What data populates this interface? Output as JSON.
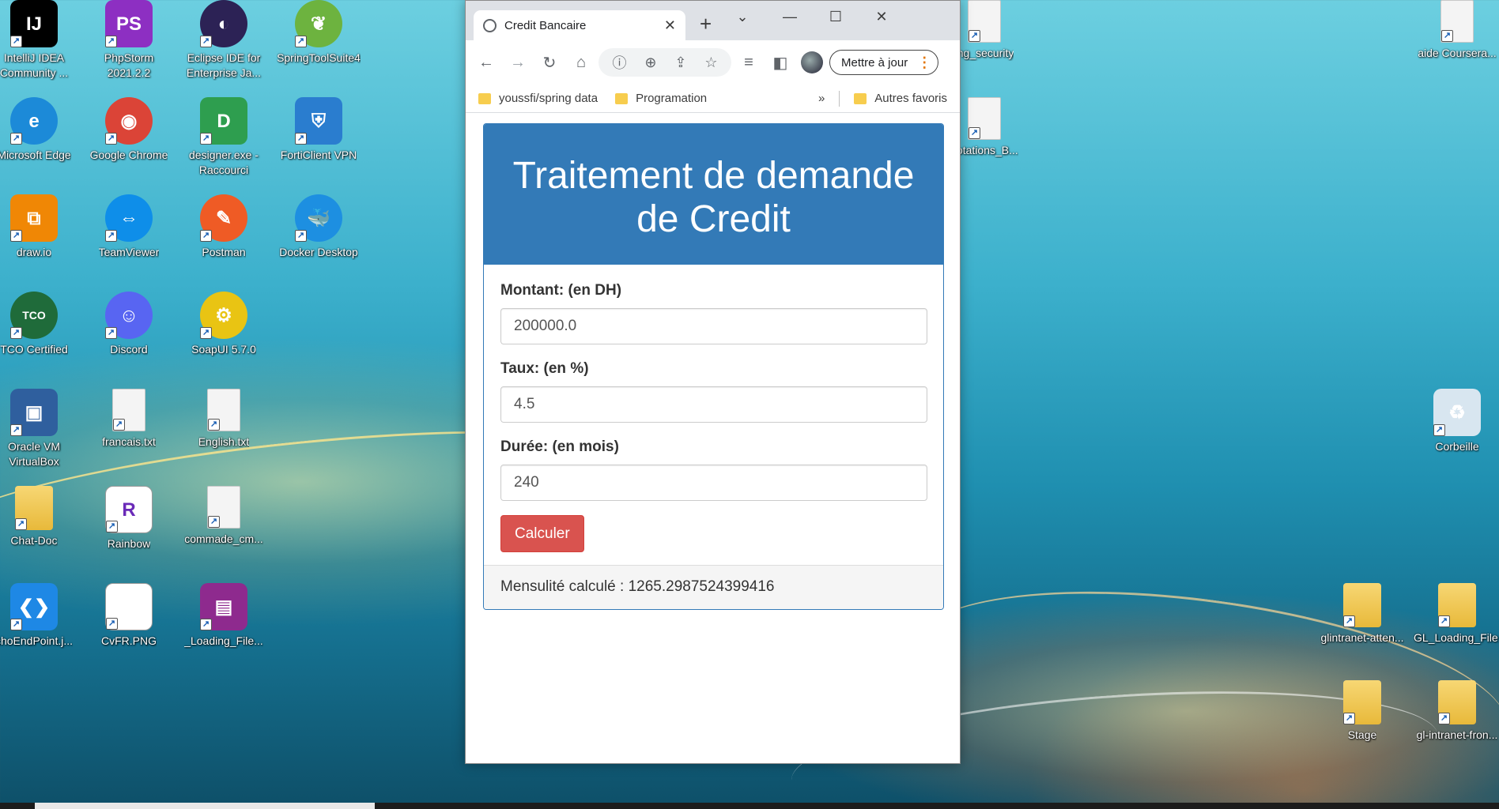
{
  "desktop": {
    "icons_left": [
      {
        "id": "intellij",
        "label": "IntelliJ IDEA Community ...",
        "glyph": "IJ",
        "color": "#000000"
      },
      {
        "id": "phpstorm",
        "label": "PhpStorm 2021.2.2",
        "glyph": "PS",
        "color": "#8d2fc2"
      },
      {
        "id": "eclipse",
        "label": "Eclipse IDE for Enterprise Ja...",
        "glyph": "◐",
        "color": "#2c2255"
      },
      {
        "id": "springtoolsuite",
        "label": "SpringToolSuite4",
        "glyph": "❦",
        "color": "#6db33f"
      },
      {
        "id": "edge",
        "label": "Microsoft Edge",
        "glyph": "e",
        "color": "#1c8ad8"
      },
      {
        "id": "chrome",
        "label": "Google Chrome",
        "glyph": "◉",
        "color": "#db4437"
      },
      {
        "id": "designer",
        "label": "designer.exe - Raccourci",
        "glyph": "D",
        "color": "#2e9e4f"
      },
      {
        "id": "forticlient",
        "label": "FortiClient VPN",
        "glyph": "⛨",
        "color": "#2a7dcf"
      },
      {
        "id": "drawio",
        "label": "draw.io",
        "glyph": "⧉",
        "color": "#f08705"
      },
      {
        "id": "teamviewer",
        "label": "TeamViewer",
        "glyph": "⇔",
        "color": "#0e8ee9"
      },
      {
        "id": "postman",
        "label": "Postman",
        "glyph": "✎",
        "color": "#ef5b25"
      },
      {
        "id": "docker",
        "label": "Docker Desktop",
        "glyph": "🐳",
        "color": "#1d8fe1"
      },
      {
        "id": "tcocertified",
        "label": "TCO Certified",
        "glyph": "TCO",
        "color": "#1f6b3a"
      },
      {
        "id": "discord",
        "label": "Discord",
        "glyph": "☺",
        "color": "#5865f2"
      },
      {
        "id": "soapui",
        "label": "SoapUI 5.7.0",
        "glyph": "⚙",
        "color": "#e9c413"
      },
      {
        "id": "virtualbox",
        "label": "Oracle VM VirtualBox",
        "glyph": "▣",
        "color": "#2f5f9e"
      },
      {
        "id": "francais",
        "label": "francais.txt",
        "glyph": "",
        "color": "#f4f4f4"
      },
      {
        "id": "english",
        "label": "English.txt",
        "glyph": "",
        "color": "#f4f4f4"
      },
      {
        "id": "chatdoc",
        "label": "Chat-Doc",
        "glyph": "",
        "color": "#e8b93a"
      },
      {
        "id": "rainbow",
        "label": "Rainbow",
        "glyph": "R",
        "color": "#ffffff"
      },
      {
        "id": "commande",
        "label": "commade_cm...",
        "glyph": "",
        "color": "#f4f4f4"
      },
      {
        "id": "echoendpoint",
        "label": "choEndPoint.j...",
        "glyph": "❮❯",
        "color": "#1e88e5"
      },
      {
        "id": "cvfr",
        "label": "CvFR.PNG",
        "glyph": "",
        "color": "#ffffff"
      },
      {
        "id": "loadingfile",
        "label": "_Loading_File...",
        "glyph": "▤",
        "color": "#8e2a8e"
      }
    ],
    "icons_right": [
      {
        "id": "springsecurity",
        "label": "ing_security",
        "glyph": "",
        "color": "#f4f4f4"
      },
      {
        "id": "annotations",
        "label": "notations_B...",
        "glyph": "",
        "color": "#f4f4f4"
      },
      {
        "id": "aidecoursera",
        "label": "aide Coursera...",
        "glyph": "",
        "color": "#f4f4f4"
      },
      {
        "id": "corbeille",
        "label": "Corbeille",
        "glyph": "♻",
        "color": "#d8e6f0"
      },
      {
        "id": "glintranet",
        "label": "glintranet-atten...",
        "glyph": "",
        "color": "#e8b93a"
      },
      {
        "id": "glloading",
        "label": "GL_Loading_File...",
        "glyph": "",
        "color": "#e8b93a"
      },
      {
        "id": "stage",
        "label": "Stage",
        "glyph": "",
        "color": "#e8b93a"
      },
      {
        "id": "glintranetfront",
        "label": "gl-intranet-fron...",
        "glyph": "",
        "color": "#e8b93a"
      }
    ]
  },
  "browser": {
    "tab_title": "Credit Bancaire",
    "update_label": "Mettre à jour",
    "bookmarks": {
      "item1": "youssfi/spring data",
      "item2": "Programation",
      "more": "»",
      "other": "Autres favoris"
    }
  },
  "page": {
    "heading": "Traitement de demande de Credit",
    "fields": {
      "montant": {
        "label": "Montant: (en DH)",
        "value": "200000.0"
      },
      "taux": {
        "label": "Taux: (en %)",
        "value": "4.5"
      },
      "duree": {
        "label": "Durée: (en mois)",
        "value": "240"
      }
    },
    "submit_label": "Calculer",
    "result_text": "Mensulité calculé : 1265.2987524399416"
  },
  "colors": {
    "primary": "#337ab7",
    "danger": "#d9534f",
    "footer_bg": "#f5f5f5"
  }
}
